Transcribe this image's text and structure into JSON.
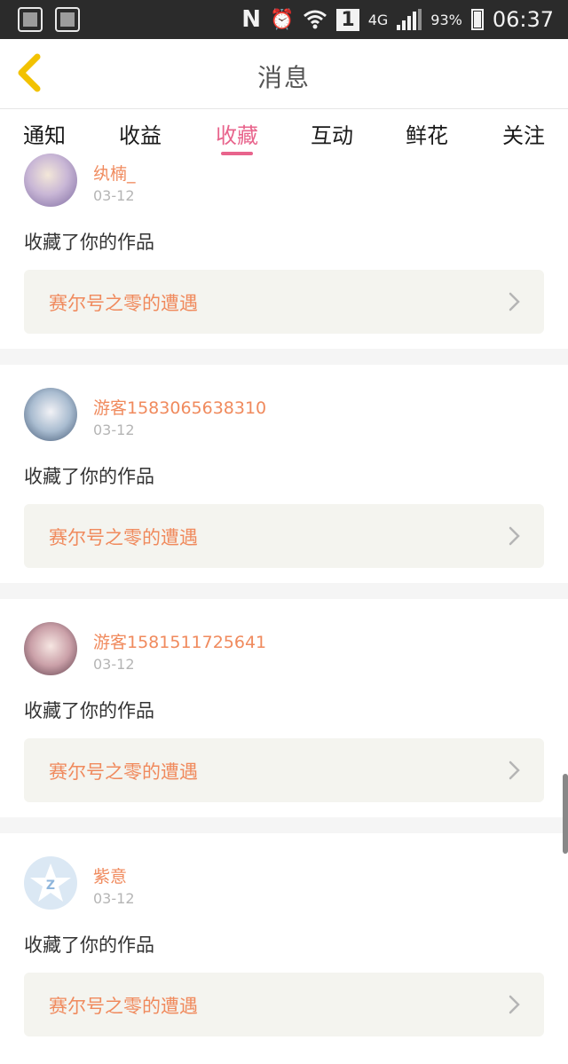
{
  "status_bar": {
    "network": "4G",
    "sim": "1",
    "battery": "93%",
    "time": "06:37",
    "icons": [
      "image-icon",
      "baidu-paw-icon",
      "nfc-icon",
      "alarm-icon",
      "wifi-icon",
      "signal-icon",
      "battery-icon"
    ]
  },
  "header": {
    "title": "消息",
    "back_icon": "chevron-left-icon"
  },
  "tabs": [
    {
      "label": "通知"
    },
    {
      "label": "收益"
    },
    {
      "label": "收藏"
    },
    {
      "label": "互动"
    },
    {
      "label": "鲜花"
    },
    {
      "label": "关注"
    }
  ],
  "active_tab": "收藏",
  "messages": [
    {
      "user": "纨楠_",
      "date": "03-12",
      "text": "收藏了你的作品",
      "work": "赛尔号之零的遭遇"
    },
    {
      "user": "游客1583065638310",
      "date": "03-12",
      "text": "收藏了你的作品",
      "work": "赛尔号之零的遭遇"
    },
    {
      "user": "游客1581511725641",
      "date": "03-12",
      "text": "收藏了你的作品",
      "work": "赛尔号之零的遭遇"
    },
    {
      "user": "紫意",
      "date": "03-12",
      "text": "收藏了你的作品",
      "work": "赛尔号之零的遭遇"
    }
  ],
  "colors": {
    "accent": "#e8648c",
    "username": "#f08a5d",
    "date": "#b5b5b5",
    "work_bg": "#f4f4ef",
    "separator": "#f5f5f5",
    "back_arrow": "#f2c200"
  }
}
